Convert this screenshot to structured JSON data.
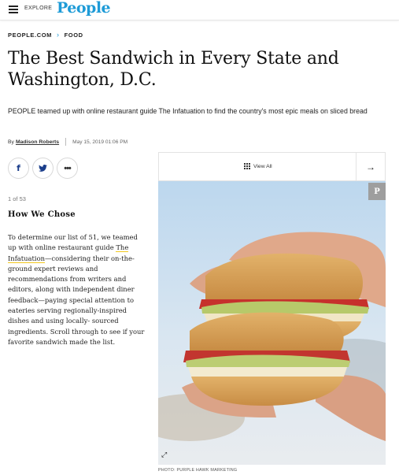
{
  "header": {
    "menu_label": "EXPLORE",
    "logo_text": "People",
    "brand_color": "#1e9bd7"
  },
  "breadcrumb": {
    "site": "PEOPLE.COM",
    "separator": "›",
    "section": "FOOD"
  },
  "article": {
    "title": "The Best Sandwich in Every State and Washington, D.C.",
    "dek": "PEOPLE teamed up with online restaurant guide The Infatuation to find the country's most epic meals on sliced bread",
    "byline_prefix": "By",
    "author": "Madison Roberts",
    "date": "May 15, 2019 01:06 PM"
  },
  "share": {
    "facebook_icon": "f",
    "twitter_icon": "twitter-bird-icon",
    "more_icon": "•••"
  },
  "gallery": {
    "view_all_label": "View All",
    "next_icon": "→",
    "counter": "1 of 53",
    "slide_title": "How We Chose",
    "body_before_link": "To determine our list of 51, we teamed up with online restaurant guide ",
    "body_link": "The Infatuation",
    "body_after_link": "—considering their on-the-ground expert reviews and recommendations from writers and editors, along with independent diner feedback—paying special attention to eateries serving regionally-inspired dishes and using locally- sourced ingredients. Scroll through to see if your favorite sandwich made the list.",
    "pin_icon": "P",
    "expand_icon": "⤢",
    "photo_credit": "PHOTO: PURPLE HAWK MARKETING"
  }
}
